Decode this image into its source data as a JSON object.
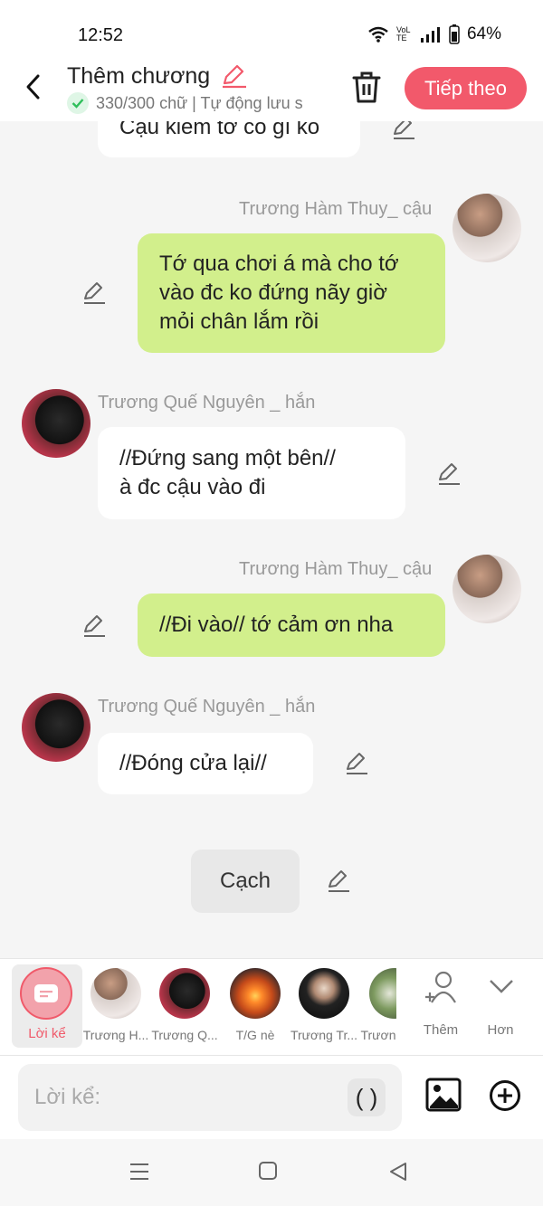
{
  "status": {
    "time": "12:52",
    "network": "VoLTE",
    "battery": "64%"
  },
  "header": {
    "title": "Thêm chương",
    "subtitle": "330/300 chữ | Tự động lưu s",
    "next_label": "Tiếp theo"
  },
  "messages": [
    {
      "kind": "left",
      "text_lines": [
        "Cậu kiếm tớ có gì ko"
      ]
    },
    {
      "kind": "right",
      "name": "Trương Hàm Thuy_ cậu",
      "text_lines": [
        "Tớ qua chơi á mà cho tớ",
        "vào đc ko đứng nãy giờ",
        "mỏi chân lắm rồi"
      ]
    },
    {
      "kind": "left",
      "name": "Trương Quế Nguyên _ hắn",
      "text_lines": [
        "//Đứng sang một bên//",
        "à đc cậu vào đi"
      ]
    },
    {
      "kind": "right",
      "name": "Trương Hàm Thuy_ cậu",
      "text_lines": [
        "//Đi vào// tớ cảm ơn nha"
      ]
    },
    {
      "kind": "left",
      "name": "Trương Quế Nguyên _ hắn",
      "text_lines": [
        "//Đóng cửa lại//"
      ]
    },
    {
      "kind": "narration",
      "text": "Cạch"
    }
  ],
  "characters": {
    "selected": {
      "label": "Lời kể"
    },
    "items": [
      {
        "label": "Trương H..."
      },
      {
        "label": "Trương Q..."
      },
      {
        "label": "T/G nè"
      },
      {
        "label": "Trương Tr..."
      },
      {
        "label": "Trươn"
      }
    ],
    "add_label": "Thêm",
    "more_label": "Hơn"
  },
  "input": {
    "placeholder": "Lời kể:",
    "paren": "( )"
  },
  "icons": [
    "back-icon",
    "pencil-icon",
    "trash-icon",
    "check-icon",
    "image-icon",
    "plus-circle-icon",
    "add-person-icon",
    "chevron-down-icon",
    "menu-icon",
    "home-icon",
    "back-triangle-icon"
  ],
  "colors": {
    "accent": "#f2596b",
    "bubble_green": "#d2ef8c",
    "bubble_white": "#ffffff"
  }
}
